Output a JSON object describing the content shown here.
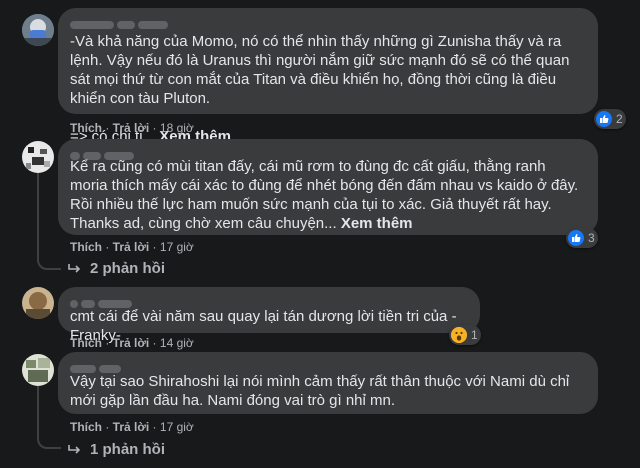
{
  "comments": [
    {
      "author_hidden": "(tên bị làm mờ)",
      "text": "-Và khả năng của Momo, nó có thể nhìn thấy những gì Zunisha thấy và ra lệnh. Vậy nếu đó là Uranus thì người nắm giữ sức mạnh đó sẽ có thể quan sát mọi thứ từ con mắt của Titan và điều khiển họ, đồng thời cũng là điều khiển con tàu Pluton.\n\n=> có chi ti...",
      "see_more": "Xem thêm",
      "like": "Thích",
      "reply": "Trả lời",
      "time": "18 giờ",
      "reaction_icon": "like-icon",
      "reaction_count": "2"
    },
    {
      "author_hidden": "(tên bị làm mờ)",
      "text": "Kể ra cũng có mùi titan đấy, cái mũ rơm to đùng đc cất giấu, thằng ranh moria thích mấy cái xác to đùng để nhét bóng đến đấm nhau vs kaido ở đây. Rồi nhiều thế lực ham muốn sức mạnh của tụi to xác. Giả thuyết rất hay. Thanks ad, cùng chờ xem câu chuyện...",
      "see_more": "Xem thêm",
      "like": "Thích",
      "reply": "Trả lời",
      "time": "17 giờ",
      "reaction_icon": "like-icon",
      "reaction_count": "3",
      "replies": "2 phản hồi"
    },
    {
      "author_hidden": "(tên bị làm mờ)",
      "text": "cmt cái để vài năm sau quay lại tán dương lời tiền tri của -Franky-",
      "like": "Thích",
      "reply": "Trả lời",
      "time": "14 giờ",
      "reaction_icon": "haha-icon",
      "reaction_count": "1"
    },
    {
      "author_hidden": "(tên bị làm mờ)",
      "text": "Vậy tại sao Shirahoshi lại nói mình cảm thấy rất thân thuộc với Nami dù chỉ mới gặp lần đầu ha. Nami đóng vai trò gì nhỉ mn.",
      "like": "Thích",
      "reply": "Trả lời",
      "time": "17 giờ",
      "replies": "1 phản hồi"
    }
  ],
  "colors": {
    "background": "#18191a",
    "bubble": "#3a3b3c",
    "text": "#e4e6eb",
    "secondary_text": "#b0b3b8",
    "like_blue": "#1877f2",
    "haha_yellow": "#f7b125"
  }
}
